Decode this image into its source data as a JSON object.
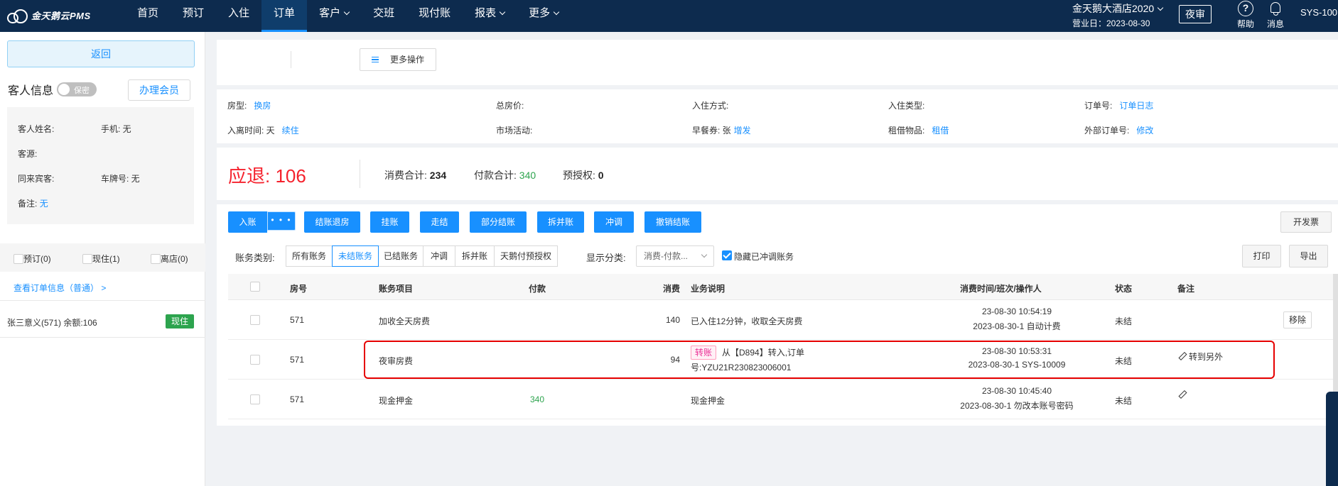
{
  "topbar": {
    "brand": "金天鹅云PMS",
    "nav": [
      {
        "label": "首页",
        "dropdown": false,
        "active": false
      },
      {
        "label": "预订",
        "dropdown": false,
        "active": false
      },
      {
        "label": "入住",
        "dropdown": false,
        "active": false
      },
      {
        "label": "订单",
        "dropdown": false,
        "active": true
      },
      {
        "label": "客户",
        "dropdown": true,
        "active": false
      },
      {
        "label": "交班",
        "dropdown": false,
        "active": false
      },
      {
        "label": "现付账",
        "dropdown": false,
        "active": false
      },
      {
        "label": "报表",
        "dropdown": true,
        "active": false
      },
      {
        "label": "更多",
        "dropdown": true,
        "active": false
      }
    ],
    "hotel_name": "金天鹅大酒店2020",
    "business_day": "营业日：2023-08-30",
    "night_audit": "夜审",
    "help": "帮助",
    "messages": "消息",
    "user": "SYS-100"
  },
  "sidebar": {
    "back": "返回",
    "guest_info_title": "客人信息",
    "privacy_toggle": "保密",
    "member_button": "办理会员",
    "guest_name_label": "客人姓名:",
    "phone": "手机: 无",
    "source_label": "客源:",
    "companions_label": "同来宾客:",
    "plate": "车牌号: 无",
    "remark_label": "备注:",
    "remark_value": "无",
    "tabs": [
      {
        "label": "预订(0)"
      },
      {
        "label": "现住(1)"
      },
      {
        "label": "离店(0)"
      }
    ],
    "order_link": "查看订单信息（普通） >",
    "resident_text": "张三意义(571)  余额:106",
    "resident_badge": "现住"
  },
  "header_panel": {
    "more_ops": "更多操作",
    "room_type_label": "房型:",
    "room_type_action": "换房",
    "total_price_label": "总房价:",
    "checkin_method_label": "入住方式:",
    "checkin_type_label": "入住类型:",
    "order_no_label": "订单号:",
    "order_log": "订单日志",
    "stay_time_label": "入离时间: 天",
    "extend": "续住",
    "market_label": "市场活动:",
    "breakfast_label": "早餐券: 张",
    "breakfast_action": "增发",
    "rental_label": "租借物品:",
    "rental_action": "租借",
    "external_order_label": "外部订单号:",
    "modify": "修改"
  },
  "summary": {
    "refund_label": "应退:",
    "refund_value": "106",
    "consume_label": "消费合计:",
    "consume_value": "234",
    "payment_label": "付款合计:",
    "payment_value": "340",
    "preauth_label": "预授权:",
    "preauth_value": "0"
  },
  "actions": {
    "post": "入账",
    "more": "• • •",
    "checkout": "结账退房",
    "hang": "挂账",
    "walk": "走结",
    "partial": "部分结账",
    "split": "拆并账",
    "reverse": "冲调",
    "cancel_checkout": "撤销结账",
    "invoice": "开发票",
    "print": "打印",
    "export": "导出"
  },
  "filters": {
    "category_label": "账务类别:",
    "categories": [
      {
        "label": "所有账务",
        "active": false
      },
      {
        "label": "未结账务",
        "active": true
      },
      {
        "label": "已结账务",
        "active": false
      },
      {
        "label": "冲调",
        "active": false
      },
      {
        "label": "拆并账",
        "active": false
      },
      {
        "label": "天鹅付预授权",
        "active": false
      }
    ],
    "display_label": "显示分类:",
    "display_value": "消费-付款...",
    "hide_reversed": "隐藏已冲调账务",
    "hide_reversed_checked": true
  },
  "table": {
    "headers": {
      "room": "房号",
      "item": "账务项目",
      "payment": "付款",
      "consume": "消费",
      "desc": "业务说明",
      "time": "消费时间/班次/操作人",
      "status": "状态",
      "remark": "备注"
    },
    "rows": [
      {
        "room": "571",
        "item": "加收全天房费",
        "payment": "",
        "consume": "140",
        "tag": "",
        "desc1": "已入住12分钟，收取全天房费",
        "desc2": "",
        "time1": "23-08-30 10:54:19",
        "time2": "2023-08-30-1 自动计费",
        "status": "未结",
        "remark": "",
        "action": "移除"
      },
      {
        "room": "571",
        "item": "夜审房费",
        "payment": "",
        "consume": "94",
        "tag": "转账",
        "desc1": "从【D894】转入,订单",
        "desc2": "号:YZU21R230823006001",
        "time1": "23-08-30 10:53:31",
        "time2": "2023-08-30-1 SYS-10009",
        "status": "未结",
        "remark": "转到另外",
        "action": ""
      },
      {
        "room": "571",
        "item": "现金押金",
        "payment": "340",
        "consume": "",
        "tag": "",
        "desc1": "现金押金",
        "desc2": "",
        "time1": "23-08-30 10:45:40",
        "time2": "2023-08-30-1 勿改本账号密码",
        "status": "未结",
        "remark": "",
        "action": ""
      }
    ]
  }
}
